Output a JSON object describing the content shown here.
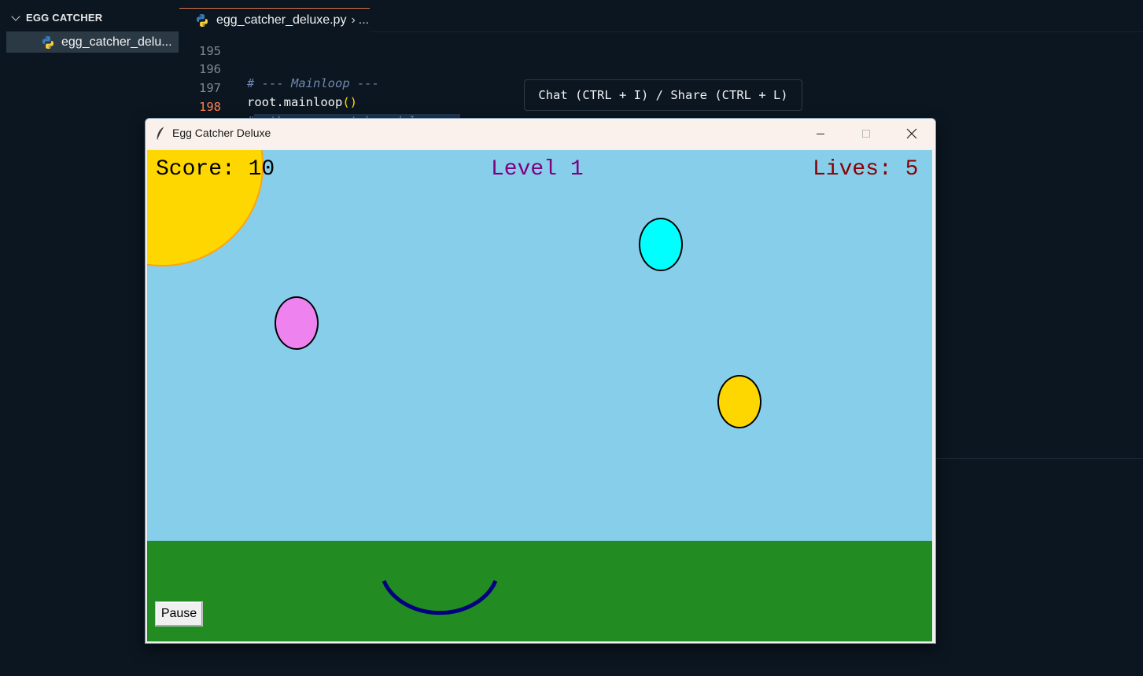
{
  "explorer": {
    "folder_name": "EGG CATCHER",
    "file_label": "egg_catcher_delu..."
  },
  "editor": {
    "tab_title": "egg_catcher_deluxe.py",
    "breadcrumb_more": "...",
    "lines": [
      {
        "number": "195",
        "text": ""
      },
      {
        "number": "196",
        "text": "# --- Mainloop ---"
      },
      {
        "number": "197",
        "text_main": "root.mainloop",
        "text_parens": "()"
      },
      {
        "number": "198",
        "text": "#python egg_catcher_deluxe.py"
      }
    ],
    "active_line": "198"
  },
  "chat_hint": "Chat (CTRL + I) / Share (CTRL + L)",
  "tk_window": {
    "title": "Egg Catcher Deluxe",
    "buttons": {
      "minimize": "minimize",
      "maximize": "maximize",
      "close": "close"
    }
  },
  "game": {
    "score_text": "Score: 10",
    "level_text": "Level 1",
    "lives_text": "Lives: 5",
    "pause_label": "Pause",
    "colors": {
      "sky": "#87ceeb",
      "grass": "#228b22",
      "sun": "#ffd700",
      "sun_outline": "#ffa500",
      "score": "#000000",
      "level": "#800080",
      "lives": "#8b0000",
      "basket": "#000080"
    },
    "eggs": [
      {
        "name": "pink-egg",
        "color": "#ee82ee"
      },
      {
        "name": "cyan-egg",
        "color": "#00ffff"
      },
      {
        "name": "yellow-egg",
        "color": "#ffd700"
      }
    ]
  }
}
